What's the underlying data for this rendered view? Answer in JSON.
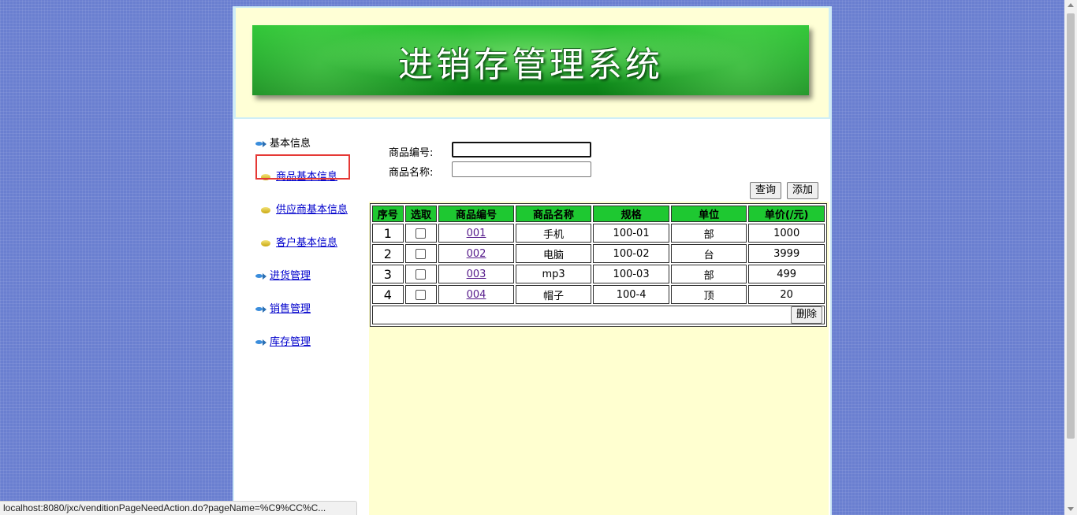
{
  "header": {
    "title": "进销存管理系统"
  },
  "sidebar": {
    "items": [
      {
        "label": "基本信息",
        "icon": "fish-icon",
        "link": false
      },
      {
        "label": "商品基本信息",
        "icon": "leaf-icon",
        "link": true
      },
      {
        "label": "供应商基本信息",
        "icon": "leaf-icon",
        "link": true
      },
      {
        "label": "客户基本信息",
        "icon": "leaf-icon",
        "link": true
      },
      {
        "label": "进货管理",
        "icon": "fish-icon",
        "link": true
      },
      {
        "label": "销售管理",
        "icon": "fish-icon",
        "link": true
      },
      {
        "label": "库存管理",
        "icon": "fish-icon",
        "link": true
      }
    ]
  },
  "search": {
    "code_label": "商品编号:",
    "code_value": "",
    "name_label": "商品名称:",
    "name_value": "",
    "query_button": "查询",
    "add_button": "添加"
  },
  "table": {
    "headers": [
      "序号",
      "选取",
      "商品编号",
      "商品名称",
      "规格",
      "单位",
      "单价(/元)"
    ],
    "rows": [
      {
        "index": "1",
        "code": "001",
        "name": "手机",
        "spec": "100-01",
        "unit": "部",
        "price": "1000"
      },
      {
        "index": "2",
        "code": "002",
        "name": "电脑",
        "spec": "100-02",
        "unit": "台",
        "price": "3999"
      },
      {
        "index": "3",
        "code": "003",
        "name": "mp3",
        "spec": "100-03",
        "unit": "部",
        "price": "499"
      },
      {
        "index": "4",
        "code": "004",
        "name": "帽子",
        "spec": "100-4",
        "unit": "顶",
        "price": "20"
      }
    ],
    "delete_button": "删除"
  },
  "status_bar": {
    "url": "localhost:8080/jxc/venditionPageNeedAction.do?pageName=%C9%CC%C..."
  },
  "colors": {
    "header_green": "#1ec831",
    "content_bg": "#ffffd0",
    "page_bg": "#6a7fd0"
  }
}
